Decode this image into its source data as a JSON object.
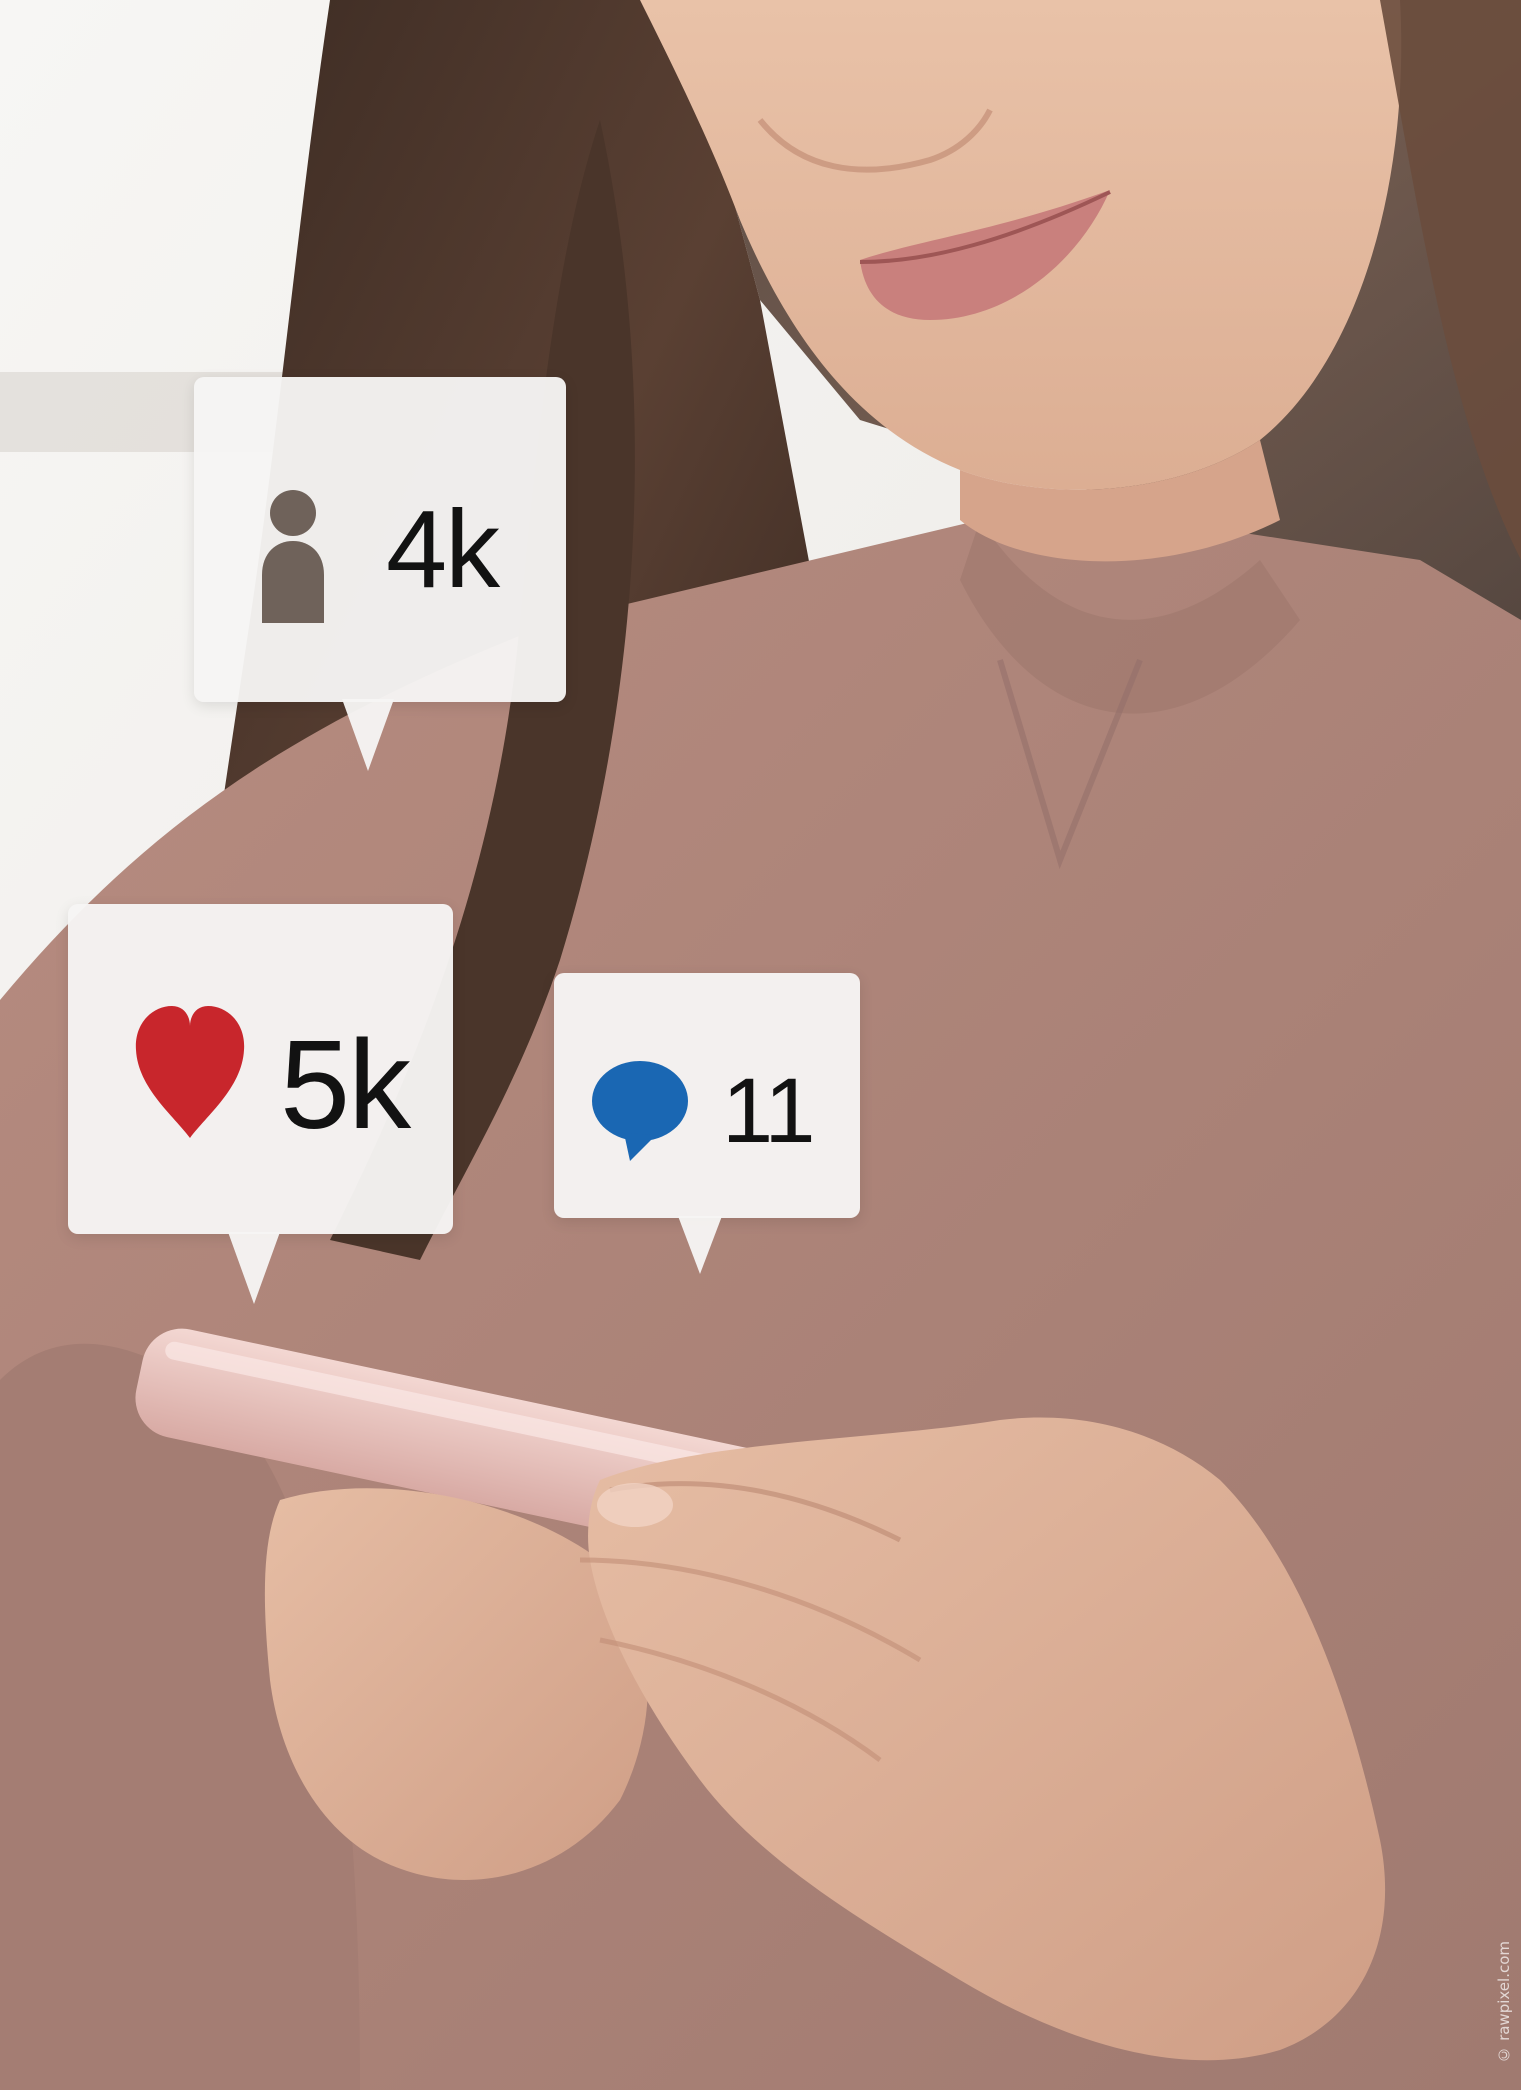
{
  "photo": {
    "subject": "woman-using-smartphone"
  },
  "notifications": [
    {
      "icon": "user-icon",
      "count": "4k",
      "color": "#6f625a"
    },
    {
      "icon": "heart-icon",
      "count": "5k",
      "color": "#c8262c"
    },
    {
      "icon": "comment-icon",
      "count": "11",
      "color": "#1a67b3"
    }
  ],
  "watermark": "© rawpixel.com"
}
